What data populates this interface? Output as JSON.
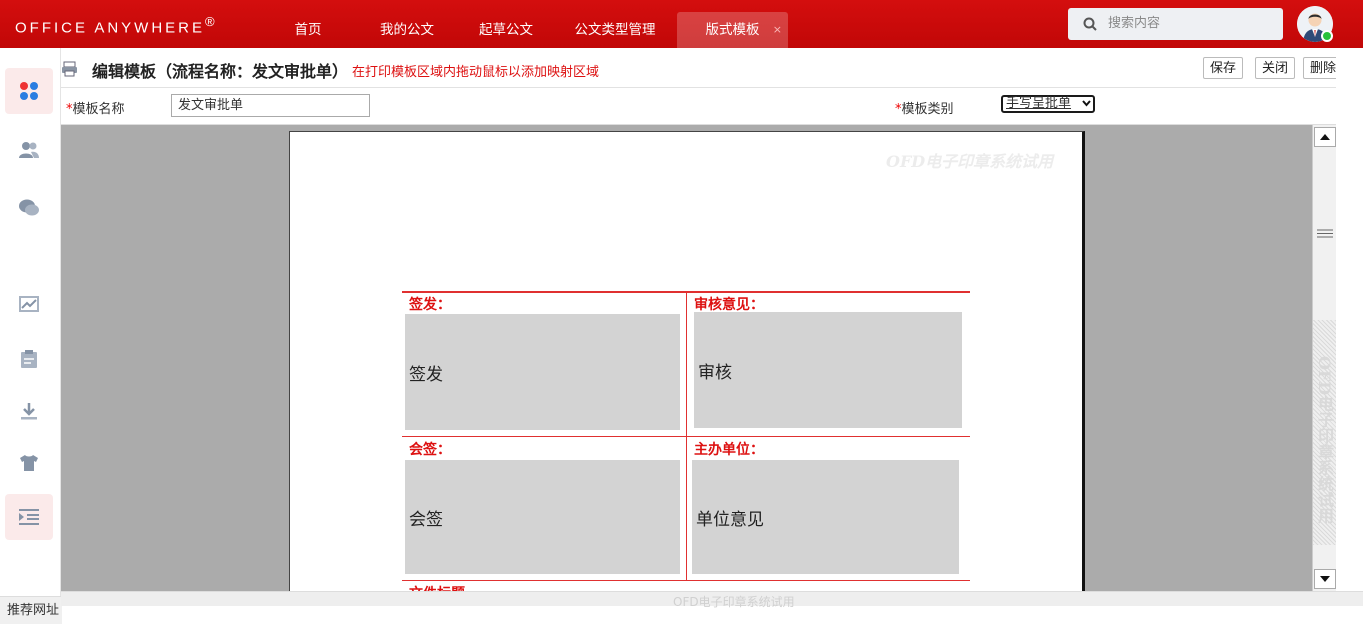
{
  "brand": {
    "logo": "Office Anywhere",
    "reg": "®"
  },
  "nav": {
    "items": [
      "首页",
      "我的公文",
      "起草公文",
      "公文类型管理",
      "版式模板"
    ],
    "active_close": "×"
  },
  "search": {
    "placeholder": "搜索内容"
  },
  "leftbar": {
    "icons": [
      "apps-grid-icon",
      "users-icon",
      "chat-icon",
      "chart-icon",
      "clipboard-icon",
      "download-icon",
      "shirt-icon",
      "indent-icon"
    ],
    "recommend": "推荐网址"
  },
  "header": {
    "title": "编辑模板（流程名称：发文审批单）",
    "hint": "在打印模板区域内拖动鼠标以添加映射区域",
    "buttons": {
      "save": "保存",
      "close": "关闭",
      "delete": "删除"
    }
  },
  "form": {
    "name_label": "模板名称",
    "name_value": "发文审批单",
    "type_label": "模板类别",
    "type_value": "手写呈批单",
    "required_mark": "*"
  },
  "document": {
    "watermark": "OFD电子印章系统试用",
    "cells": [
      {
        "label": "签发：",
        "field": "签发"
      },
      {
        "label": "审核意见：",
        "field": "审核"
      },
      {
        "label": "会签：",
        "field": "会签"
      },
      {
        "label": "主办单位：",
        "field": "单位意见"
      }
    ],
    "next_label": "文件标题"
  },
  "colors": {
    "brand_red": "#c80a0a",
    "accent_red": "#e03030",
    "field_gray": "#d3d3d3"
  }
}
